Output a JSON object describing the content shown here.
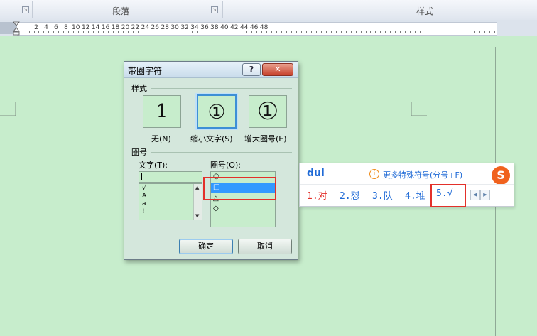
{
  "ribbon": {
    "paragraph_group": "段落",
    "style_group": "样式",
    "launcher_glyph": "↘"
  },
  "ruler": {
    "numbers": [
      "2",
      "4",
      "6",
      "8",
      "10",
      "12",
      "14",
      "16",
      "18",
      "20",
      "22",
      "24",
      "26",
      "28",
      "30",
      "32",
      "34",
      "36",
      "38",
      "40",
      "42",
      "44",
      "46",
      "48"
    ]
  },
  "dialog": {
    "title": "带圈字符",
    "help_label": "?",
    "close_label": "✕",
    "style_section": "样式",
    "styles": [
      {
        "glyph": "1",
        "label": "无(N)"
      },
      {
        "glyph": "①",
        "label": "缩小文字(S)"
      },
      {
        "glyph": "①",
        "label": "增大圈号(E)"
      }
    ],
    "selected_style": "缩小文字(S)",
    "enclosure_section": "圈号",
    "text_label": "文字(T):",
    "text_value": "",
    "text_list": [
      "√",
      "A",
      "a",
      "!"
    ],
    "circle_label": "圈号(O):",
    "circle_list": [
      "○",
      "□",
      "△",
      "◇"
    ],
    "selected_circle": "□",
    "ok_label": "确定",
    "cancel_label": "取消"
  },
  "ime": {
    "pinyin": "dui",
    "tip_icon": "i",
    "tip": "更多特殊符号(分号+F)",
    "logo": "S",
    "candidates": [
      "1.对",
      "2.怼",
      "3.队",
      "4.堆",
      "5.√"
    ],
    "prev_page": "◀",
    "next_page": "▶"
  },
  "colors": {
    "eye_protection_green": "#c7edcc",
    "selection_blue": "#3399ff",
    "highlight_red": "#e3302a",
    "ime_blue": "#1f6ad6"
  }
}
